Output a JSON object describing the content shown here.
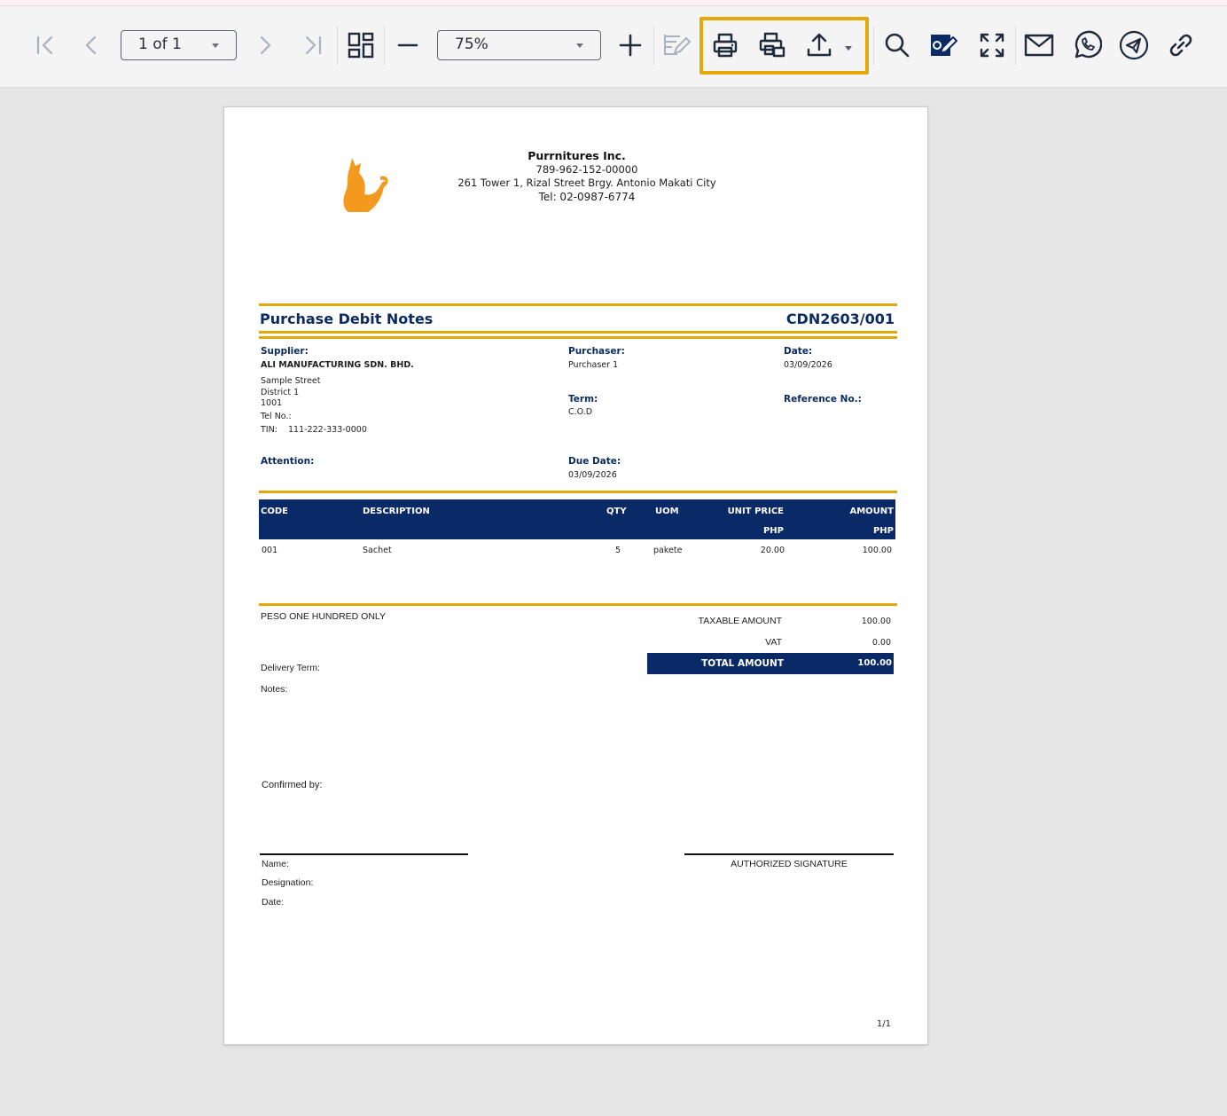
{
  "toolbar": {
    "page_indicator": "1 of 1",
    "zoom_level": "75%",
    "icons": [
      "first-page-icon",
      "previous-page-icon",
      "next-page-icon",
      "last-page-icon",
      "thumbnails-icon",
      "zoom-out-icon",
      "zoom-in-icon",
      "edit-form-icon",
      "print-icon",
      "print-setup-icon",
      "export-icon",
      "search-icon",
      "sign-icon",
      "fullscreen-icon",
      "email-icon",
      "whatsapp-icon",
      "telegram-icon",
      "link-icon"
    ],
    "highlight_color": "#e3a90b"
  },
  "company": {
    "name": "Purrnitures Inc.",
    "reg_no": "789-962-152-00000",
    "address": "261 Tower 1, Rizal Street Brgy. Antonio Makati City",
    "tel": "Tel: 02-0987-6774"
  },
  "document": {
    "title": "Purchase Debit Notes",
    "number": "CDN2603/001"
  },
  "supplier": {
    "label": "Supplier:",
    "name": "ALI MANUFACTURING SDN. BHD.",
    "line1": "Sample Street",
    "line2": "District 1",
    "line3": "1001",
    "tel": "Tel No.:",
    "tin_label": "TIN:",
    "tin": "111-222-333-0000"
  },
  "purchaser": {
    "label": "Purchaser:",
    "value": "Purchaser 1"
  },
  "date": {
    "label": "Date:",
    "value": "03/09/2026"
  },
  "term": {
    "label": "Term:",
    "value": "C.O.D"
  },
  "reference": {
    "label": "Reference No.:"
  },
  "attention": {
    "label": "Attention:"
  },
  "due_date": {
    "label": "Due Date:",
    "value": "03/09/2026"
  },
  "table": {
    "headers": {
      "code": "CODE",
      "description": "DESCRIPTION",
      "qty": "QTY",
      "uom": "UOM",
      "unit_price": "UNIT PRICE",
      "unit_price_currency": "PHP",
      "amount": "AMOUNT",
      "amount_currency": "PHP"
    },
    "rows": [
      {
        "code": "001",
        "description": "Sachet",
        "qty": "5",
        "uom": "pakete",
        "unit_price": "20.00",
        "amount": "100.00"
      }
    ]
  },
  "summary": {
    "amount_in_words": "PESO ONE HUNDRED  ONLY",
    "taxable_label": "TAXABLE AMOUNT",
    "taxable_value": "100.00",
    "vat_label": "VAT",
    "vat_value": "0.00",
    "total_label": "TOTAL AMOUNT",
    "total_value": "100.00"
  },
  "footer": {
    "delivery_term": "Delivery Term:",
    "notes": "Notes:",
    "confirmed_by": "Confirmed by:",
    "name": "Name:",
    "designation": "Designation:",
    "date": "Date:",
    "authorized_signature": "AUTHORIZED SIGNATURE",
    "page_number": "1/1"
  },
  "colors": {
    "navy": "#092a66",
    "gold": "#e3a90b",
    "logo_orange": "#f39a1e"
  }
}
